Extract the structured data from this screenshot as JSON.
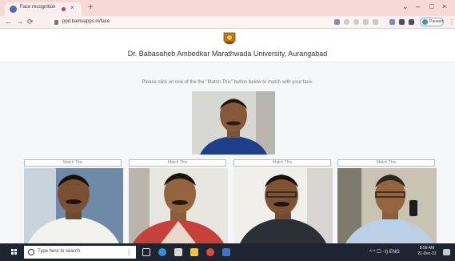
{
  "browser": {
    "tab_title": "Face recognition",
    "tab_close": "×",
    "new_tab": "+",
    "url": "ppd.bamuapps.in/face",
    "profile_label": "Paused",
    "window_controls": {
      "chevron": "⌄",
      "minimize": "–",
      "maximize": "□",
      "close": "×"
    },
    "nav": {
      "back": "←",
      "forward": "→",
      "reload": "⟳"
    },
    "kebab": "⋮"
  },
  "page": {
    "university_name": "Dr. Babasaheb Ambedkar Marathwada University, Aurangabad",
    "instruction": "Please click on one of the the \"Match This\" button below to match with your face.",
    "match_button_label": "Match This",
    "candidates_count": 4
  },
  "taskbar": {
    "search_placeholder": "Type here to search",
    "systray_text": "ᴬ ^ 🖵 ◁) ENG",
    "time": "8:58 AM",
    "date": "21-Dec-22"
  },
  "colors": {
    "tabstrip": "#f7d9d6",
    "toolbar": "#fbeeee",
    "page_bg": "#f6f7f9",
    "button_border": "#9fc0d8",
    "taskbar": "#1f2530"
  }
}
